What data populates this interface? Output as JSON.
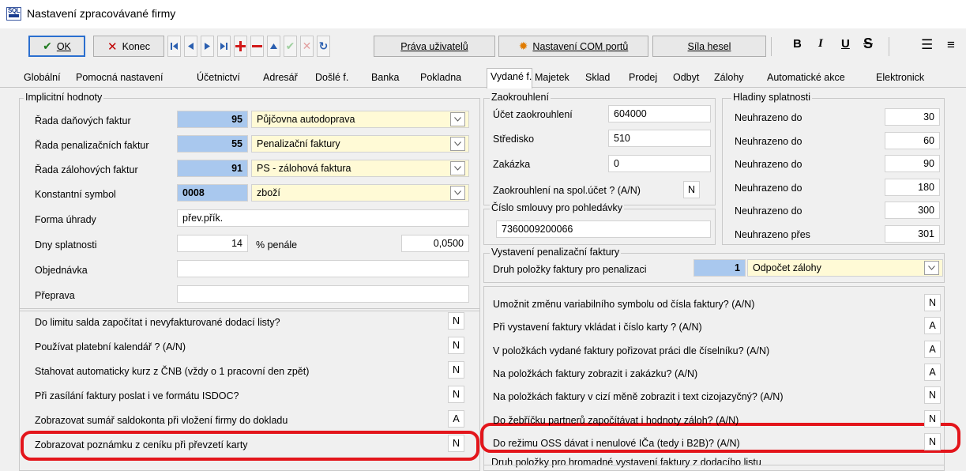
{
  "window": {
    "title": "Nastavení zpracovávané firmy",
    "icon_text": "SQL"
  },
  "toolbar": {
    "ok_label": "OK",
    "close_label": "Konec",
    "rights_label": "Práva uživatelů",
    "com_label": "Nastavení COM portů",
    "password_label": "Síla hesel",
    "bold": "B",
    "italic": "I",
    "underline": "U",
    "strike": "S"
  },
  "tabs": [
    "Globální",
    "Pomocná nastavení",
    "Účetnictví",
    "Adresář",
    "Došlé f.",
    "Banka",
    "Pokladna",
    "Vydané f.",
    "Majetek",
    "Sklad",
    "Prodej",
    "Odbyt",
    "Zálohy",
    "Automatické akce",
    "Elektronick"
  ],
  "active_tab": "Vydané f.",
  "implicit": {
    "legend": "Implicitní hodnoty",
    "rows": [
      {
        "label": "Řada daňových faktur",
        "code": "95",
        "name": "Půjčovna autodoprava"
      },
      {
        "label": "Řada penalizačních faktur",
        "code": "55",
        "name": "Penalizační faktury"
      },
      {
        "label": "Řada zálohových faktur",
        "code": "91",
        "name": "PS - zálohová faktura"
      },
      {
        "label": "Konstantní symbol",
        "code": "0008",
        "name": "zboží"
      }
    ],
    "payment_label": "Forma úhrady",
    "payment_value": "přev.přík.",
    "due_label": "Dny splatnosti",
    "due_value": "14",
    "penalty_label": "% penále",
    "penalty_value": "0,0500",
    "order_label": "Objednávka",
    "order_value": "",
    "transport_label": "Přeprava",
    "transport_value": ""
  },
  "left_options": [
    {
      "label": "Do limitu salda započítat i nevyfakturované dodací listy?",
      "value": "N"
    },
    {
      "label": "Používat platební kalendář ? (A/N)",
      "value": "N"
    },
    {
      "label": "Stahovat automaticky kurz z ČNB (vždy o 1 pracovní den zpět)",
      "value": "N"
    },
    {
      "label": "Při zasílání faktury poslat i ve formátu ISDOC?",
      "value": "N"
    },
    {
      "label": "Zobrazovat sumář saldokonta při vložení firmy do dokladu",
      "value": "A"
    },
    {
      "label": "Zobrazovat poznámku z ceníku při převzetí karty",
      "value": "N"
    }
  ],
  "rounding": {
    "legend": "Zaokrouhlení",
    "account_label": "Účet zaokrouhlení",
    "account_value": "604000",
    "center_label": "Středisko",
    "center_value": "510",
    "job_label": "Zakázka",
    "job_value": "0",
    "common_label": "Zaokrouhlení na spol.účet ? (A/N)",
    "common_value": "N"
  },
  "contract": {
    "legend": "Číslo smlouvy pro pohledávky",
    "value": "7360009200066"
  },
  "levels": {
    "legend": "Hladiny splatnosti",
    "rows": [
      {
        "label": "Neuhrazeno do",
        "value": "30"
      },
      {
        "label": "Neuhrazeno do",
        "value": "60"
      },
      {
        "label": "Neuhrazeno do",
        "value": "90"
      },
      {
        "label": "Neuhrazeno do",
        "value": "180"
      },
      {
        "label": "Neuhrazeno do",
        "value": "300"
      },
      {
        "label": "Neuhrazeno přes",
        "value": "301"
      }
    ]
  },
  "penalty_invoice": {
    "legend": "Vystavení penalizační faktury",
    "label": "Druh položky faktury pro penalizaci",
    "code": "1",
    "name": "Odpočet zálohy"
  },
  "right_options": [
    {
      "label": "Umožnit změnu variabilního symbolu od čísla faktury? (A/N)",
      "value": "N"
    },
    {
      "label": "Při vystavení faktury vkládat i číslo karty ? (A/N)",
      "value": "A"
    },
    {
      "label": "V položkách vydané faktury pořizovat práci dle číselníku? (A/N)",
      "value": "A"
    },
    {
      "label": "Na položkách faktury zobrazit i zakázku? (A/N)",
      "value": "A"
    },
    {
      "label": "Na položkách faktury v cizí měně zobrazit i text cizojazyčný? (A/N)",
      "value": "N"
    },
    {
      "label": "Do žebříčku partnerů započítávat i hodnoty záloh? (A/N)",
      "value": "N"
    },
    {
      "label": "Do režimu OSS dávat i nenulové IČa (tedy i B2B)? (A/N)",
      "value": "N"
    }
  ],
  "bulk_legend": "Druh položky pro hromadné vystavení faktury z dodacího listu",
  "colors": {
    "highlight": "#e3151b",
    "code_field": "#a9c8ee",
    "name_field": "#fffad6"
  }
}
